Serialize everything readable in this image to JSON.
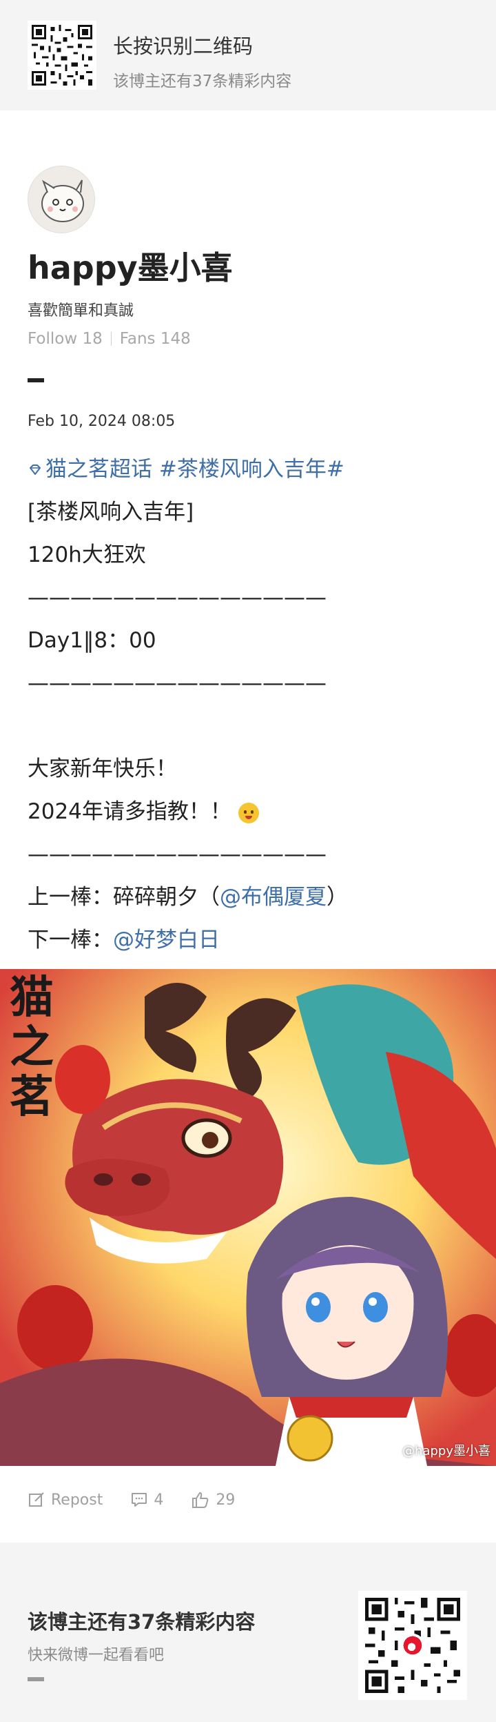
{
  "top_banner": {
    "title": "长按识别二维码",
    "subtitle": "该博主还有37条精彩内容"
  },
  "profile": {
    "username": "happy墨小喜",
    "bio": "喜歡簡單和真誠",
    "follow": "Follow 18",
    "fans": "Fans 148"
  },
  "post": {
    "date": "Feb 10, 2024 08:05",
    "topic_super": "猫之茗超话",
    "topic_tag": "#茶楼风响入吉年#",
    "lines": [
      "[茶楼风响入吉年]",
      "120h大狂欢",
      "——————————————",
      "Day1‖8：00",
      "——————————————",
      "",
      "大家新年快乐！",
      "2024年请多指教！！",
      "——————————————"
    ],
    "prev_label": "上一棒：碎碎朝夕（",
    "prev_mention": "@布偶厦夏",
    "prev_close": "）",
    "next_label": "下一棒：",
    "next_mention": "@好梦白日"
  },
  "image": {
    "logo_text": "猫之茗",
    "watermark": "@happy墨小喜"
  },
  "actions": {
    "repost": "Repost",
    "comments": "4",
    "likes": "29"
  },
  "bottom_banner": {
    "title": "该博主还有37条精彩内容",
    "subtitle": "快来微博一起看看吧"
  },
  "colors": {
    "link": "#3f6fa8",
    "banner_bg": "#f4f4f4"
  }
}
